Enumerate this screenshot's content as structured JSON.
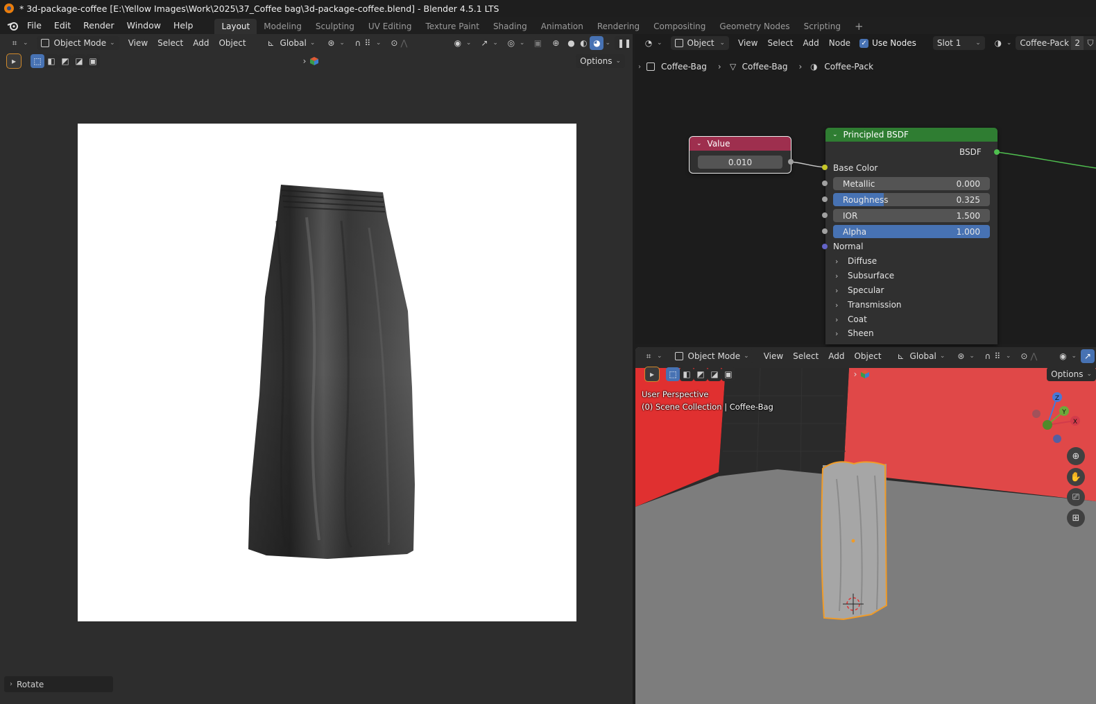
{
  "window": {
    "title": "* 3d-package-coffee [E:\\Yellow Images\\Work\\2025\\37_Coffee bag\\3d-package-coffee.blend] - Blender 4.5.1 LTS"
  },
  "menu": {
    "items": [
      "File",
      "Edit",
      "Render",
      "Window",
      "Help"
    ]
  },
  "workspaces": {
    "tabs": [
      "Layout",
      "Modeling",
      "Sculpting",
      "UV Editing",
      "Texture Paint",
      "Shading",
      "Animation",
      "Rendering",
      "Compositing",
      "Geometry Nodes",
      "Scripting"
    ],
    "active": "Layout",
    "add_symbol": "+"
  },
  "left_viewport": {
    "mode": "Object Mode",
    "menus": [
      "View",
      "Select",
      "Add",
      "Object"
    ],
    "transform_orientation": "Global",
    "options_label": "Options",
    "last_operator": "Rotate"
  },
  "node_editor": {
    "object_type": "Object",
    "menus": [
      "View",
      "Select",
      "Add",
      "Node"
    ],
    "use_nodes_label": "Use Nodes",
    "use_nodes_checked": true,
    "slot": "Slot 1",
    "material": "Coffee-Pack",
    "material_users": "2",
    "breadcrumb": [
      "Coffee-Bag",
      "Coffee-Bag",
      "Coffee-Pack"
    ],
    "value_node": {
      "title": "Value",
      "value": "0.010",
      "color": "#9e2f4e"
    },
    "bsdf_node": {
      "title": "Principled BSDF",
      "color": "#2f7d32",
      "output_label": "BSDF",
      "base_color_label": "Base Color",
      "fields": [
        {
          "label": "Metallic",
          "value": "0.000",
          "fill": 0.0
        },
        {
          "label": "Roughness",
          "value": "0.325",
          "fill": 0.325
        },
        {
          "label": "IOR",
          "value": "1.500",
          "fill": 0.0
        },
        {
          "label": "Alpha",
          "value": "1.000",
          "fill": 1.0
        }
      ],
      "normal_label": "Normal",
      "panels": [
        "Diffuse",
        "Subsurface",
        "Specular",
        "Transmission",
        "Coat",
        "Sheen"
      ]
    }
  },
  "right_viewport": {
    "mode": "Object Mode",
    "menus": [
      "View",
      "Select",
      "Add",
      "Object"
    ],
    "transform_orientation": "Global",
    "options_label": "Options",
    "perspective_label": "User Perspective",
    "collection_label": "(0) Scene Collection | Coffee-Bag",
    "gizmo_axes": [
      "Z",
      "Y",
      "X"
    ]
  }
}
